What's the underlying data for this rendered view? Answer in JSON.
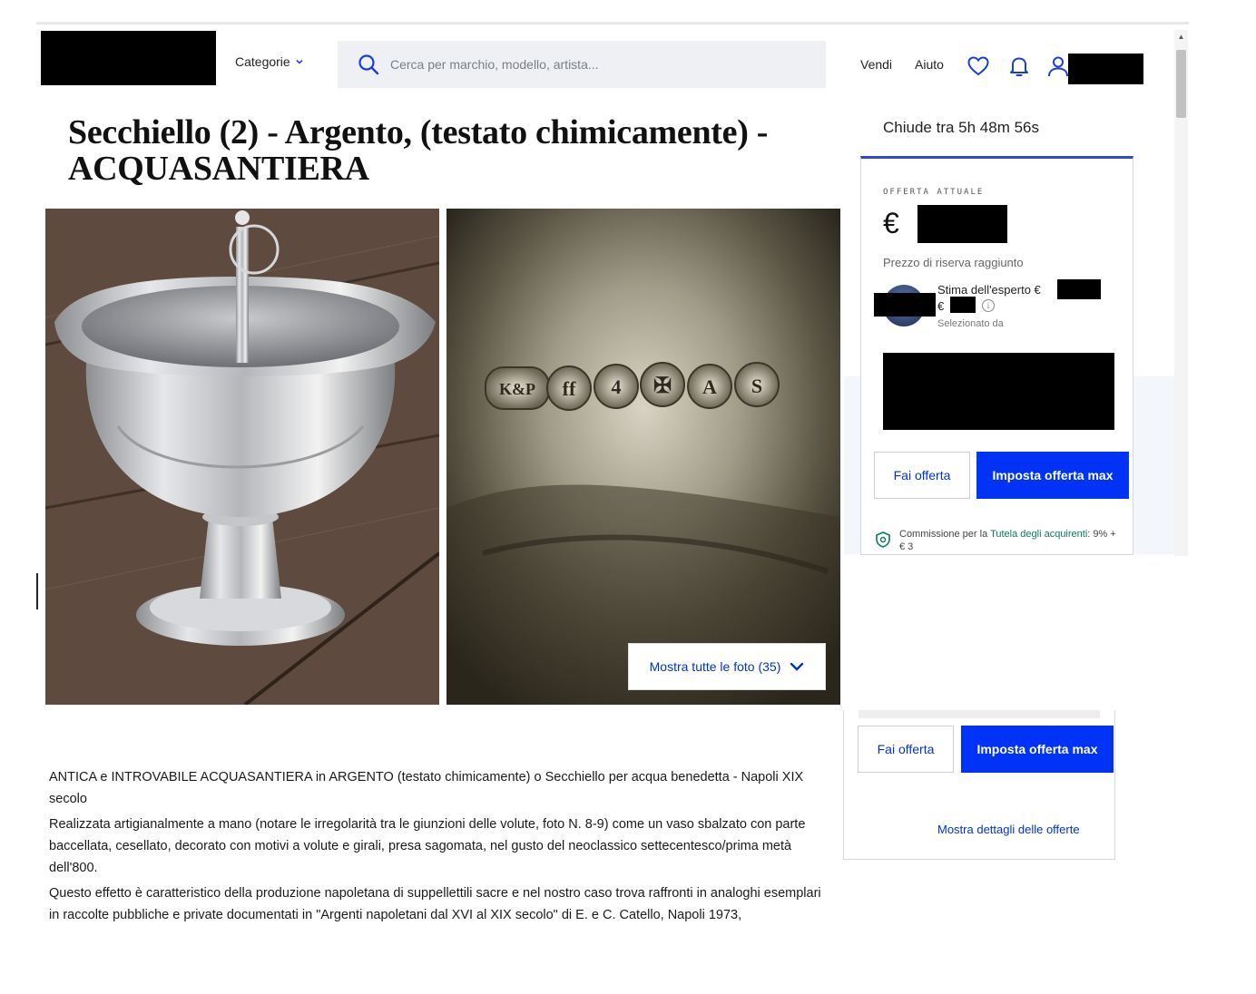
{
  "header": {
    "categorie_label": "Categorie",
    "search_placeholder": "Cerca per marchio, modello, artista...",
    "vendi_label": "Vendi",
    "aiuto_label": "Aiuto"
  },
  "listing": {
    "title": "Secchiello (2) - Argento, (testato chimicamente) - ACQUASANTIERA",
    "show_photos_label": "Mostra tutte le foto (35)",
    "hallmarks": [
      "K&P",
      "ff",
      "4",
      "✠",
      "A",
      "S"
    ]
  },
  "bid_panel": {
    "closes_in": "Chiude tra 5h 48m 56s",
    "current_offer_label": "OFFERTA ATTUALE",
    "currency_symbol": "€",
    "reserve_text": "Prezzo di riserva raggiunto",
    "estimate_label": "Stima dell'esperto €",
    "estimate_second_line": "€",
    "selected_by": "Selezionato da",
    "bid_button": "Fai offerta",
    "max_bid_button": "Imposta offerta max",
    "fee_prefix": "Commissione per la ",
    "fee_link": "Tutela degli acquirenti",
    "fee_suffix": ": 9% + € 3",
    "show_details_link": "Mostra dettagli delle offerte"
  },
  "description": {
    "paragraphs": [
      "ANTICA e INTROVABILE ACQUASANTIERA in ARGENTO (testato chimicamente) o Secchiello per acqua benedetta - Napoli XIX secolo",
      "Realizzata artigianalmente a mano (notare le irregolarità tra le giunzioni delle volute, foto N. 8-9) come un vaso sbalzato con parte baccellata, cesellato, decorato con motivi a volute e girali, presa sagomata, nel gusto del neoclassico settecentesco/prima metà dell'800.",
      "Questo effetto è caratteristico della produzione napoletana di suppellettili sacre e nel nostro caso trova raffronti in analoghi esemplari in raccolte pubbliche e private documentati in \"Argenti napoletani dal XVI al XIX secolo\" di E. e C. Catello, Napoli 1973,"
    ]
  },
  "colors": {
    "accent_blue": "#0033f5",
    "link_blue": "#0033cc",
    "panel_top_border": "#2a4ad6",
    "fee_link_green": "#0a7a5c"
  }
}
